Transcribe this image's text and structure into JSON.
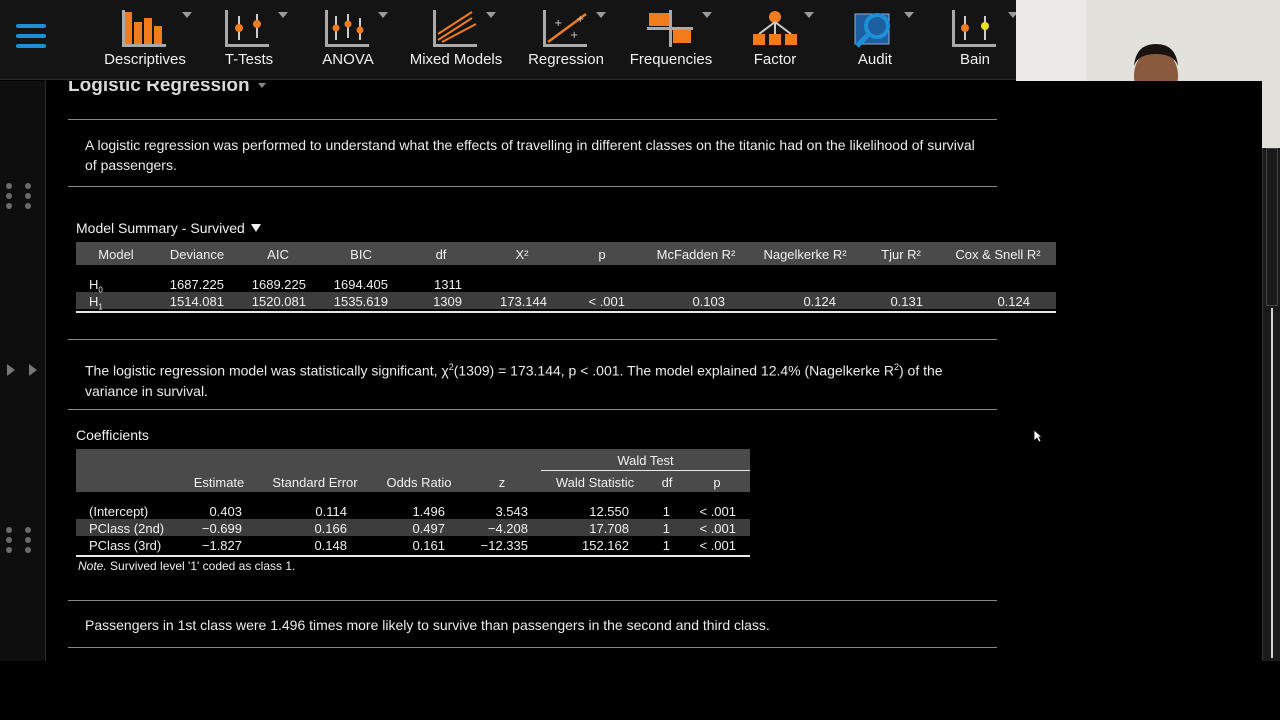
{
  "ribbon": {
    "menu_icon": "hamburger-menu-icon",
    "modules": [
      {
        "label": "Descriptives",
        "icon": "bar-chart-icon"
      },
      {
        "label": "T-Tests",
        "icon": "t-test-icon"
      },
      {
        "label": "ANOVA",
        "icon": "anova-icon"
      },
      {
        "label": "Mixed Models",
        "icon": "mixed-models-icon"
      },
      {
        "label": "Regression",
        "icon": "regression-icon"
      },
      {
        "label": "Frequencies",
        "icon": "frequencies-icon"
      },
      {
        "label": "Factor",
        "icon": "factor-icon"
      },
      {
        "label": "Audit",
        "icon": "audit-icon"
      },
      {
        "label": "Bain",
        "icon": "bain-icon"
      }
    ],
    "accent_color": "#f07c1e",
    "blue_color": "#1d8fd6"
  },
  "results": {
    "title": "Logistic Regression",
    "intro": "A logistic regression was performed to understand what the effects of travelling in different classes on the titanic had on the likelihood of survival of passengers.",
    "model_summary": {
      "title": "Model Summary - Survived",
      "headers": [
        "Model",
        "Deviance",
        "AIC",
        "BIC",
        "df",
        "Χ²",
        "p",
        "McFadden R²",
        "Nagelkerke R²",
        "Tjur R²",
        "Cox & Snell R²"
      ],
      "rows": [
        {
          "model": "H",
          "sub": "0",
          "deviance": "1687.225",
          "aic": "1689.225",
          "bic": "1694.405",
          "df": "1311",
          "chi2": "",
          "p": "",
          "mcfadden": "",
          "nagelkerke": "",
          "tjur": "",
          "coxsnell": ""
        },
        {
          "model": "H",
          "sub": "1",
          "deviance": "1514.081",
          "aic": "1520.081",
          "bic": "1535.619",
          "df": "1309",
          "chi2": "173.144",
          "p": "< .001",
          "mcfadden": "0.103",
          "nagelkerke": "0.124",
          "tjur": "0.131",
          "coxsnell": "0.124"
        }
      ]
    },
    "interpretation_1": {
      "a": "The logistic regression model was statistically significant, χ",
      "sup1": "2",
      "b": "(1309) = 173.144, p < .001. The model explained 12.4% (Nagelkerke R",
      "sup2": "2",
      "c": ") of the",
      "d": "variance in survival."
    },
    "coefficients": {
      "title": "Coefficients",
      "group_header": "Wald Test",
      "headers": [
        "",
        "Estimate",
        "Standard Error",
        "Odds Ratio",
        "z",
        "Wald Statistic",
        "df",
        "p"
      ],
      "rows": [
        {
          "term": "(Intercept)",
          "estimate": "0.403",
          "se": "0.114",
          "or": "1.496",
          "z": "3.543",
          "wald": "12.550",
          "df": "1",
          "p": "< .001"
        },
        {
          "term": "PClass (2nd)",
          "estimate": "−0.699",
          "se": "0.166",
          "or": "0.497",
          "z": "−4.208",
          "wald": "17.708",
          "df": "1",
          "p": "< .001"
        },
        {
          "term": "PClass (3rd)",
          "estimate": "−1.827",
          "se": "0.148",
          "or": "0.161",
          "z": "−12.335",
          "wald": "152.162",
          "df": "1",
          "p": "< .001"
        }
      ],
      "note_label": "Note.",
      "note_text": " Survived level '1' coded as class 1."
    },
    "interpretation_2": "Passengers in 1st class were 1.496 times more likely to survive than passengers in the second and third class."
  }
}
